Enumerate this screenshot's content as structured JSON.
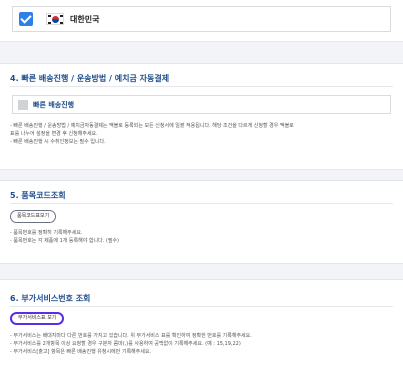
{
  "country": {
    "checked": true,
    "label": "대한민국"
  },
  "section4": {
    "title": "4. 빠른 배송진행 / 운송방법 / 예치금 자동결제",
    "express_label": "빠른 배송진행",
    "notes": [
      "- 빠른 배송진행 / 운송방법 / 예치금자동결제는 맥볼로 등록되는 모든 신청서에 일괄 적용됩니다. 해당 조건을 다르게 신청할 경우 맥볼로",
      "표를 나누어 설정을 변경 후 신청해주세요.",
      "- 빠른 배송진행 시 수취인정보는 필수 입니다."
    ]
  },
  "section5": {
    "title": "5. 품목코드조회",
    "button_label": "품목코드표보기",
    "notes": [
      "- 품목번호를 정확히 기록해주세요.",
      "- 품목번호는 각 제품에 1개 등록해야 합니다. (필수)"
    ]
  },
  "section6": {
    "title": "6. 부가서비스번호 조회",
    "button_label": "부가서비스표 보기",
    "notes": [
      "- 부가서비스는 배대지마다 다른 번호를 가지고 있습니다. 위 부가서비스 표를 확인하여 정확한 번호를 기록해주세요.",
      "- 부가서비스를 2개항목 이상 요청할 경우 구분자 콤마(,)를 사용하여 공백없이 기록해주세요. (예 : 15,19,22)",
      "- 부가서비스[출고] 항목은 빠른 배송진행 유청시에만 기록해주세요."
    ]
  }
}
